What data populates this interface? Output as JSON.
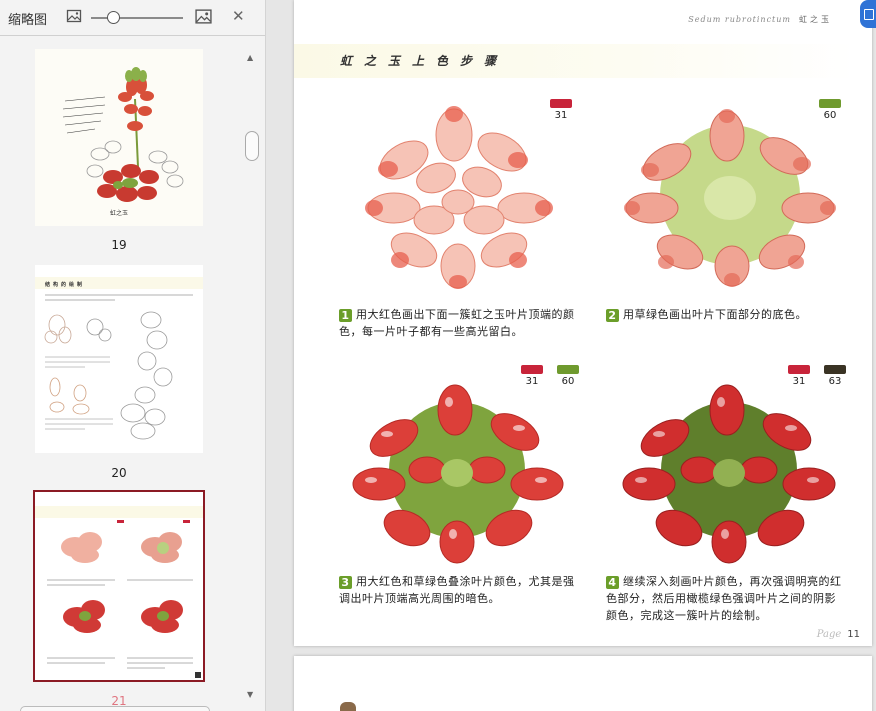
{
  "thumbnail_panel": {
    "title": "缩略图",
    "close_glyph": "✕",
    "zoom_level": 0.25,
    "pages": [
      {
        "number": "19",
        "selected": false,
        "caption": "虹之玉"
      },
      {
        "number": "20",
        "selected": false,
        "heading": "结构的绘制"
      },
      {
        "number": "21",
        "selected": true
      }
    ]
  },
  "page": {
    "latin_name": "Sedum rubrotinctum",
    "chinese_name": "虹之玉",
    "heading": "虹之玉上色步骤",
    "page_word": "Page",
    "page_number": "11",
    "steps": [
      {
        "num": "1",
        "text": "用大红色画出下面一簇虹之玉叶片顶端的颜色，每一片叶子都有一些高光留白。",
        "swatches": [
          {
            "num": "31",
            "color": "#c8243a"
          }
        ]
      },
      {
        "num": "2",
        "text": "用草绿色画出叶片下面部分的底色。",
        "swatches": [
          {
            "num": "60",
            "color": "#6f9a2e"
          }
        ]
      },
      {
        "num": "3",
        "text": "用大红色和草绿色叠涂叶片颜色，尤其是强调出叶片顶端高光周围的暗色。",
        "swatches": [
          {
            "num": "31",
            "color": "#c8243a"
          },
          {
            "num": "60",
            "color": "#6f9a2e"
          }
        ]
      },
      {
        "num": "4",
        "text": "继续深入刻画叶片颜色，再次强调明亮的红色部分，然后用橄榄绿色强调叶片之间的阴影颜色，完成这一簇叶片的绘制。",
        "swatches": [
          {
            "num": "31",
            "color": "#c8243a"
          },
          {
            "num": "63",
            "color": "#3a3324"
          }
        ]
      }
    ]
  },
  "icons": [
    "image-small-icon",
    "image-large-icon",
    "close-icon",
    "extension-icon"
  ]
}
